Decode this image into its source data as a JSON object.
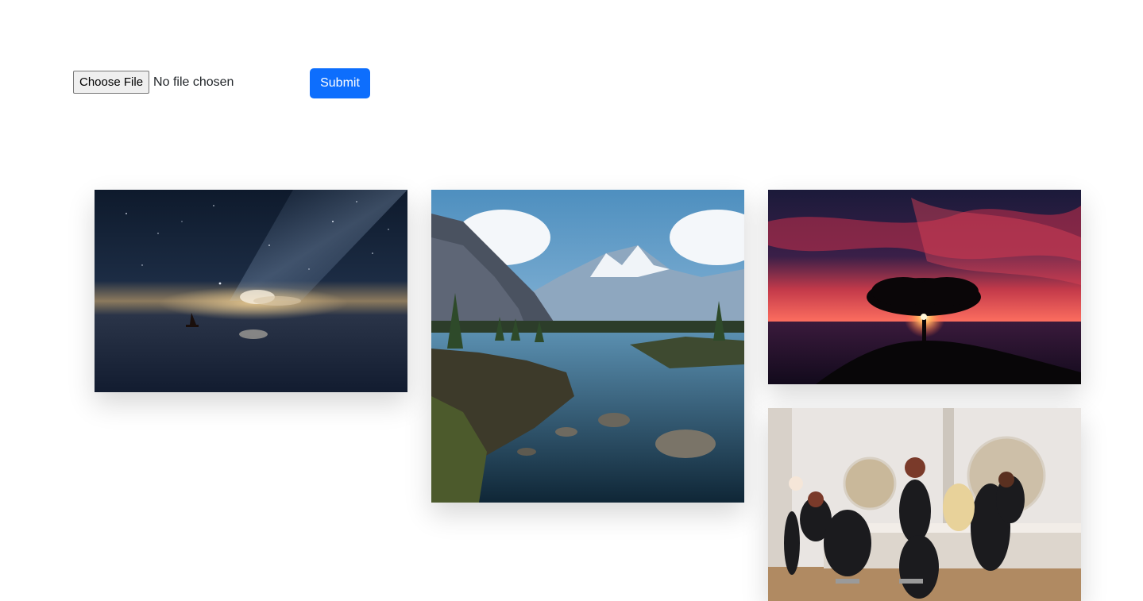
{
  "upload": {
    "choose_file_label": "Choose File",
    "file_status": "No file chosen",
    "submit_label": "Submit"
  },
  "colors": {
    "primary_button": "#0d6efd",
    "page_background": "#ffffff"
  },
  "gallery": {
    "images": [
      {
        "name": "starry-sea-sailboat-image"
      },
      {
        "name": "mountain-lake-landscape-image"
      },
      {
        "name": "red-sky-tree-sunset-image"
      },
      {
        "name": "hair-salon-image"
      }
    ]
  }
}
